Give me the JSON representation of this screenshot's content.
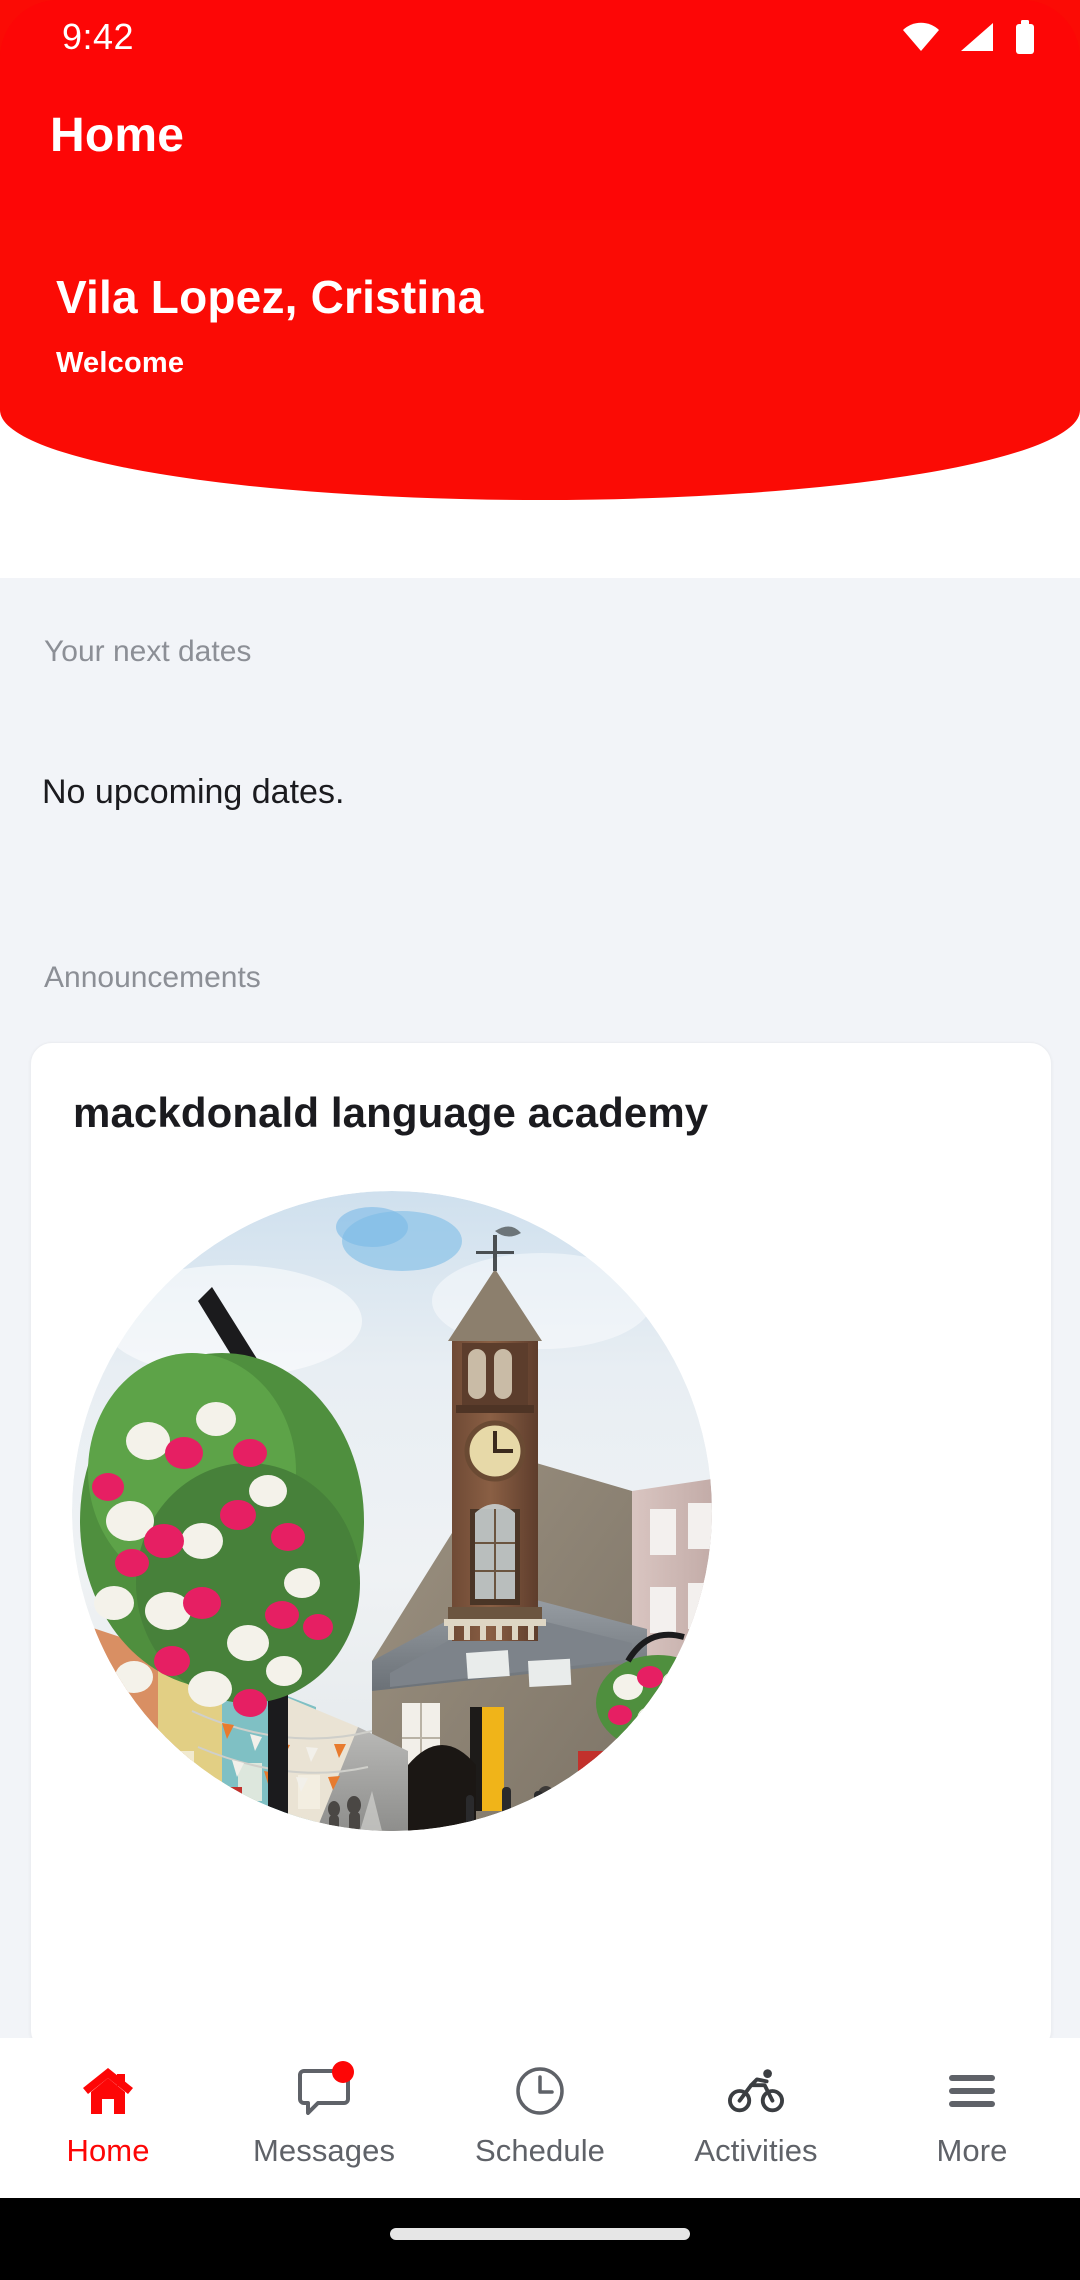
{
  "status_bar": {
    "time": "9:42",
    "icons": [
      "wifi-icon",
      "cellular-signal-icon",
      "battery-icon"
    ]
  },
  "app_bar": {
    "title": "Home",
    "background_color": "#fd0606"
  },
  "header": {
    "user_name": "Vila Lopez, Cristina",
    "greeting": "Welcome",
    "background_color": "#fb0b05",
    "text_color": "#ffffff"
  },
  "content": {
    "background_color": "#f2f4f8",
    "next_dates": {
      "label": "Your next dates",
      "empty_message": "No upcoming dates."
    },
    "announcements": {
      "label": "Announcements",
      "cards": [
        {
          "title": "mackdonald language academy",
          "image_name": "town-street-clock-tower-photo",
          "image_shape": "circle"
        }
      ]
    }
  },
  "bottom_nav": {
    "active_index": 0,
    "active_color": "#fd0606",
    "inactive_color": "#5f6268",
    "items": [
      {
        "label": "Home",
        "icon": "home-icon",
        "badge": false
      },
      {
        "label": "Messages",
        "icon": "message-icon",
        "badge": true
      },
      {
        "label": "Schedule",
        "icon": "clock-icon",
        "badge": false
      },
      {
        "label": "Activities",
        "icon": "bicycle-icon",
        "badge": false
      },
      {
        "label": "More",
        "icon": "menu-icon",
        "badge": false
      }
    ]
  },
  "gesture_bar": {
    "indicator": "home-indicator-pill"
  }
}
